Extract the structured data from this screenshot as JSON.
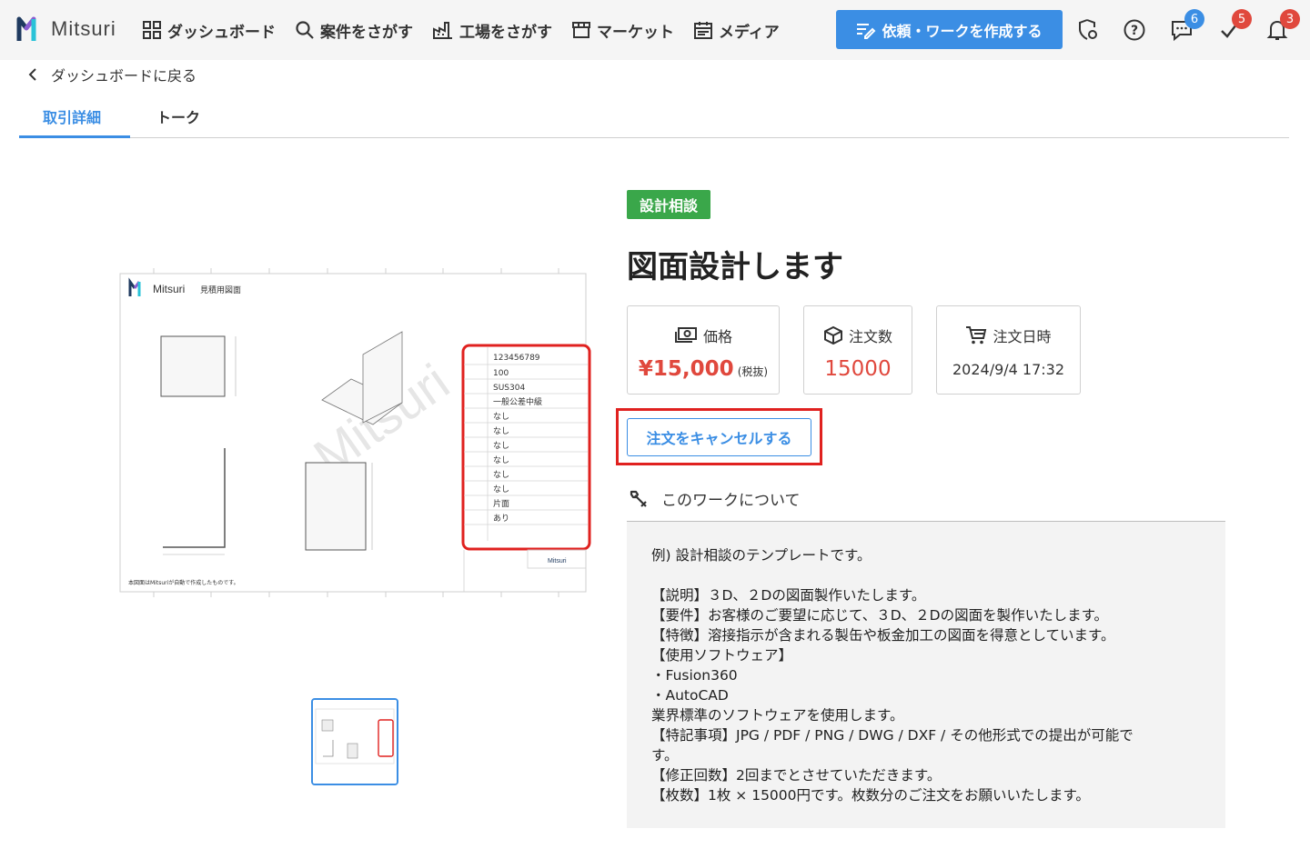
{
  "header": {
    "brand": "Mitsuri",
    "nav": [
      {
        "label": "ダッシュボード",
        "icon": "grid-icon"
      },
      {
        "label": "案件をさがす",
        "icon": "search-icon"
      },
      {
        "label": "工場をさがす",
        "icon": "factory-icon"
      },
      {
        "label": "マーケット",
        "icon": "store-icon"
      },
      {
        "label": "メディア",
        "icon": "calendar-icon"
      }
    ],
    "cta_label": "依頼・ワークを作成する",
    "badges": {
      "messages": "6",
      "tasks": "5",
      "notifications": "3"
    },
    "colors": {
      "accent": "#3b8ee4",
      "badge_blue": "#3b8ee4",
      "badge_red": "#e0483d"
    }
  },
  "back_label": "ダッシュボードに戻る",
  "tabs": [
    {
      "label": "取引詳細",
      "active": true
    },
    {
      "label": "トーク",
      "active": false
    }
  ],
  "preview": {
    "brand": "Mitsuri",
    "sheet_title": "見積用図面",
    "watermark": "Mitsuri",
    "spec_values": [
      "123456789",
      "100",
      "SUS304",
      "一般公差中級",
      "なし",
      "なし",
      "なし",
      "なし",
      "なし",
      "なし",
      "片面",
      "あり"
    ],
    "footer_note": "本図面はMitsuriが自動で作成したものです。"
  },
  "work": {
    "category": "設計相談",
    "category_color": "#3aa74a",
    "title": "図面設計します",
    "price_label": "価格",
    "price_value": "¥15,000",
    "price_note": "(税抜)",
    "count_label": "注文数",
    "count_value": "15000",
    "date_label": "注文日時",
    "date_value": "2024/9/4 17:32",
    "cancel_label": "注文をキャンセルする",
    "about_heading": "このワークについて",
    "about_text": "例) 設計相談のテンプレートです。\n\n【説明】３D、２Dの図面製作いたします。\n【要件】お客様のご要望に応じて、３D、２Dの図面を製作いたします。\n【特徴】溶接指示が含まれる製缶や板金加工の図面を得意としています。\n【使用ソフトウェア】\n・Fusion360\n・AutoCAD\n業界標準のソフトウェアを使用します。\n【特記事項】JPG / PDF / PNG / DWG / DXF / その他形式での提出が可能で\nす。\n【修正回数】2回までとさせていただきます。\n【枚数】1枚 × 15000円です。枚数分のご注文をお願いいたします。"
  }
}
